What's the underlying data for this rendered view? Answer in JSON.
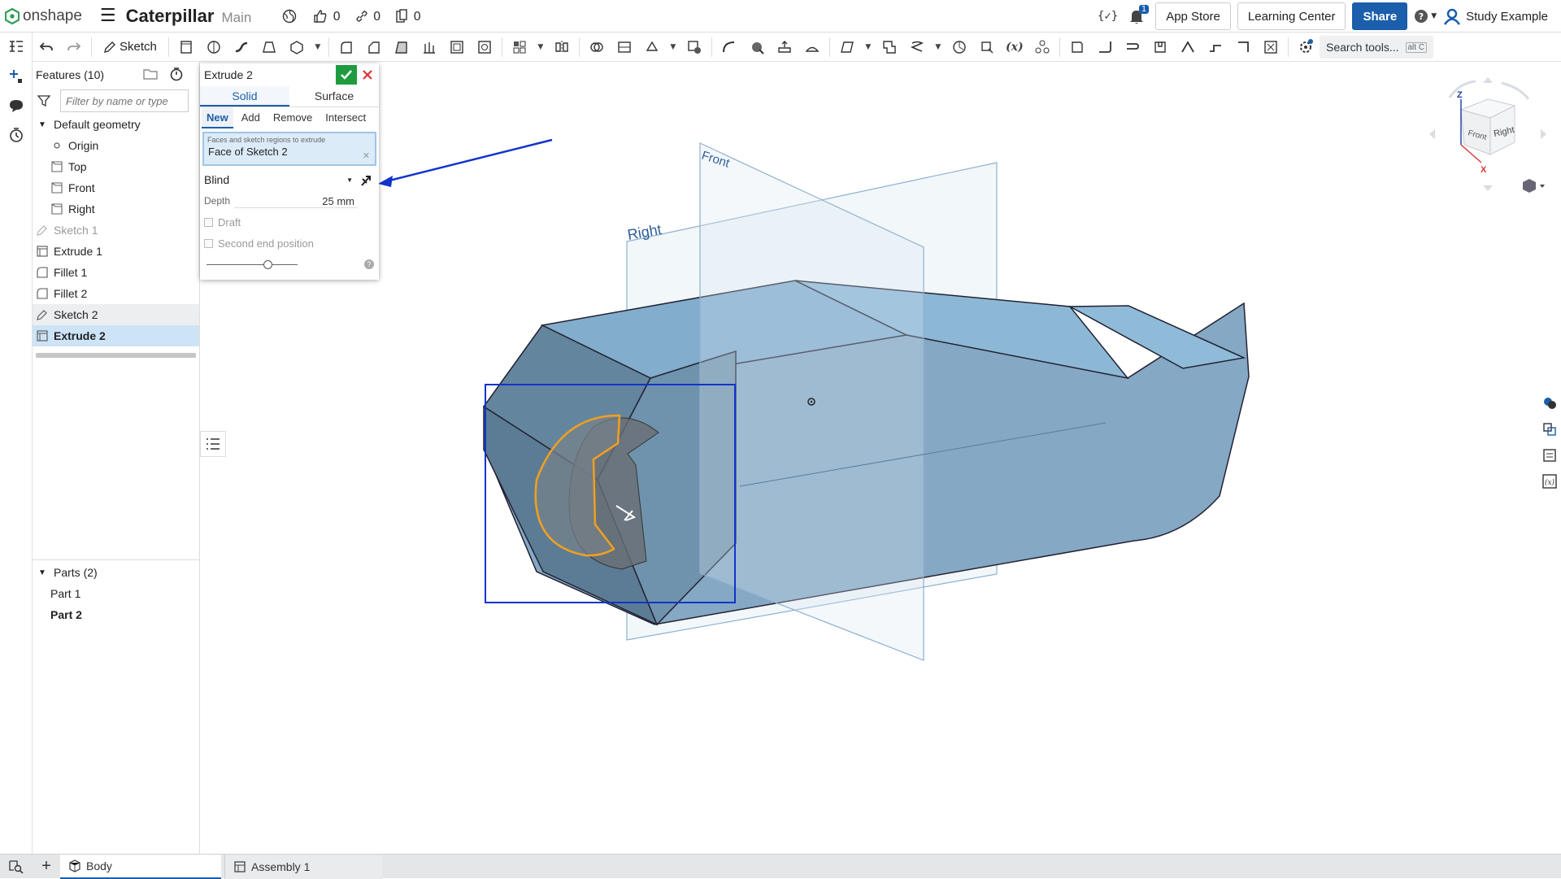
{
  "app": {
    "logo_text": "onshape",
    "doc_title": "Caterpillar",
    "branch": "Main"
  },
  "topbar": {
    "likes": "0",
    "links": "0",
    "copies": "0",
    "notifications": "1",
    "app_store": "App Store",
    "learning_center": "Learning Center",
    "share": "Share",
    "user_name": "Study Example"
  },
  "toolbar": {
    "sketch_label": "Sketch",
    "search_label": "Search tools...",
    "search_shortcut": "alt C"
  },
  "features": {
    "header": "Features (10)",
    "filter_placeholder": "Filter by name or type",
    "default_geometry": "Default geometry",
    "items": [
      {
        "label": "Origin"
      },
      {
        "label": "Top"
      },
      {
        "label": "Front"
      },
      {
        "label": "Right"
      },
      {
        "label": "Sketch 1"
      },
      {
        "label": "Extrude 1"
      },
      {
        "label": "Fillet 1"
      },
      {
        "label": "Fillet 2"
      },
      {
        "label": "Sketch 2"
      },
      {
        "label": "Extrude 2"
      }
    ],
    "parts_header": "Parts (2)",
    "parts": [
      {
        "label": "Part 1"
      },
      {
        "label": "Part 2"
      }
    ]
  },
  "dialog": {
    "title": "Extrude 2",
    "tab_solid": "Solid",
    "tab_surface": "Surface",
    "ops": [
      "New",
      "Add",
      "Remove",
      "Intersect"
    ],
    "selection_label": "Faces and sketch regions to extrude",
    "selection_value": "Face of Sketch 2",
    "end_type": "Blind",
    "depth_label": "Depth",
    "depth_value": "25 mm",
    "draft_label": "Draft",
    "second_end_label": "Second end position"
  },
  "viewport": {
    "plane_front": "Front",
    "plane_right": "Right",
    "cube_front": "Front",
    "cube_right": "Right",
    "axis_z": "Z",
    "axis_x": "X"
  },
  "bottom_tabs": [
    {
      "label": "Body"
    },
    {
      "label": "Assembly 1"
    }
  ],
  "colors": {
    "accent": "#1b5eab",
    "part": "#7fa7c4",
    "selection": "#f0a020",
    "ok": "#1e9b3f"
  }
}
